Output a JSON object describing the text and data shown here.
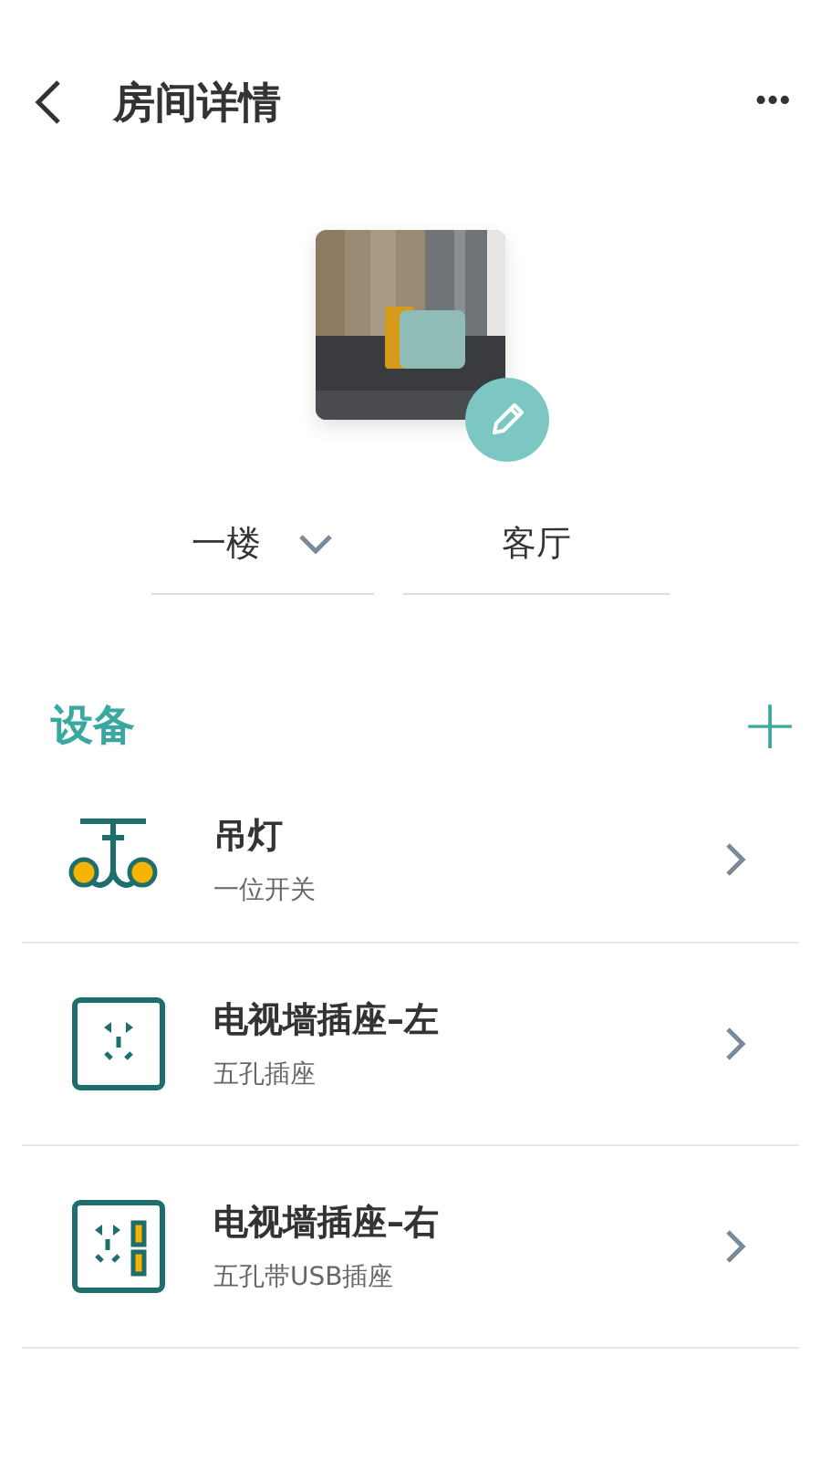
{
  "header": {
    "title": "房间详情",
    "more": "•••"
  },
  "room": {
    "floor": "一楼",
    "name": "客厅"
  },
  "devices": {
    "title": "设备",
    "add": "+",
    "items": [
      {
        "kind": "pendant",
        "name": "吊灯",
        "type": "一位开关"
      },
      {
        "kind": "socket",
        "name": "电视墙插座–左",
        "type": "五孔插座"
      },
      {
        "kind": "usb-socket",
        "name": "电视墙插座–右",
        "type": "五孔带USB插座"
      }
    ]
  }
}
